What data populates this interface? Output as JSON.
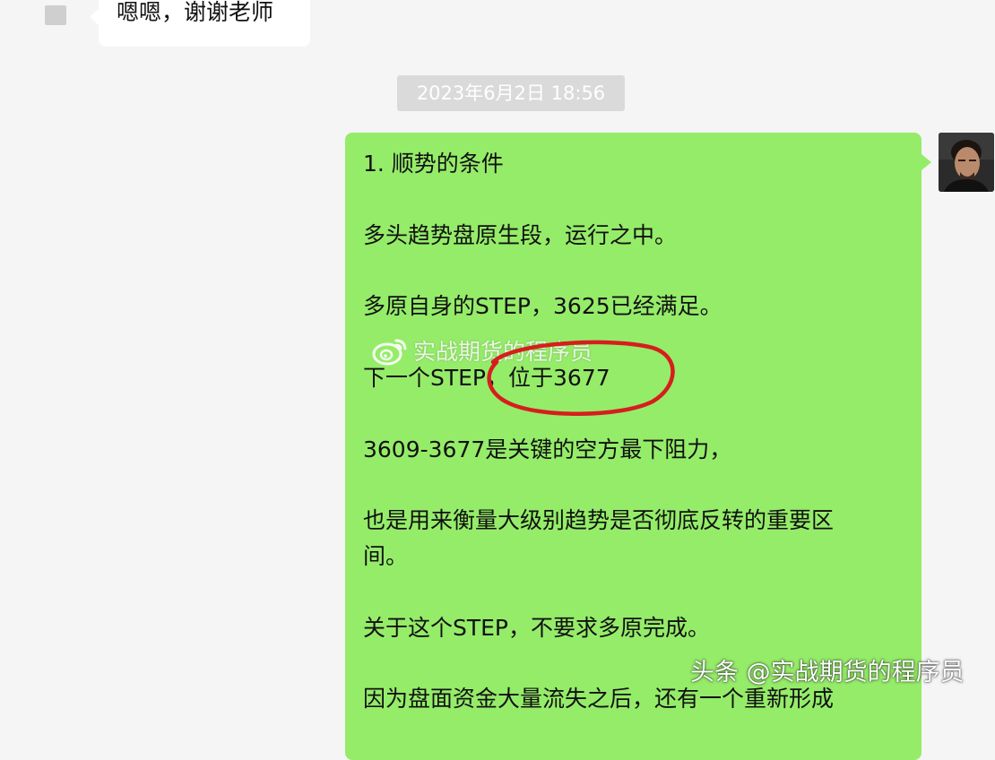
{
  "incoming": {
    "text": "嗯嗯，谢谢老师"
  },
  "timestamp": "2023年6月2日 18:56",
  "outgoing": {
    "lines": [
      "1. 顺势的条件",
      "多头趋势盘原生段，运行之中。",
      "多原自身的STEP，3625已经满足。",
      "下一个STEP，位于3677",
      "3609-3677是关键的空方最下阻力，",
      "也是用来衡量大级别趋势是否彻底反转的重要区",
      "间。",
      "关于这个STEP，不要求多原完成。",
      "因为盘面资金大量流失之后，还有一个重新形成"
    ]
  },
  "watermarks": {
    "weibo": "实战期货的程序员",
    "toutiao": "头条 @实战期货的程序员"
  },
  "colors": {
    "background": "#f5f5f5",
    "outgoing_bubble": "#95ec69",
    "incoming_bubble": "#ffffff",
    "timestamp_pill": "#dadada",
    "highlight_circle": "#d61e1e"
  },
  "icons": {
    "incoming_avatar": "contact-avatar",
    "outgoing_avatar": "user-avatar",
    "weibo_logo": "weibo-logo-icon"
  }
}
